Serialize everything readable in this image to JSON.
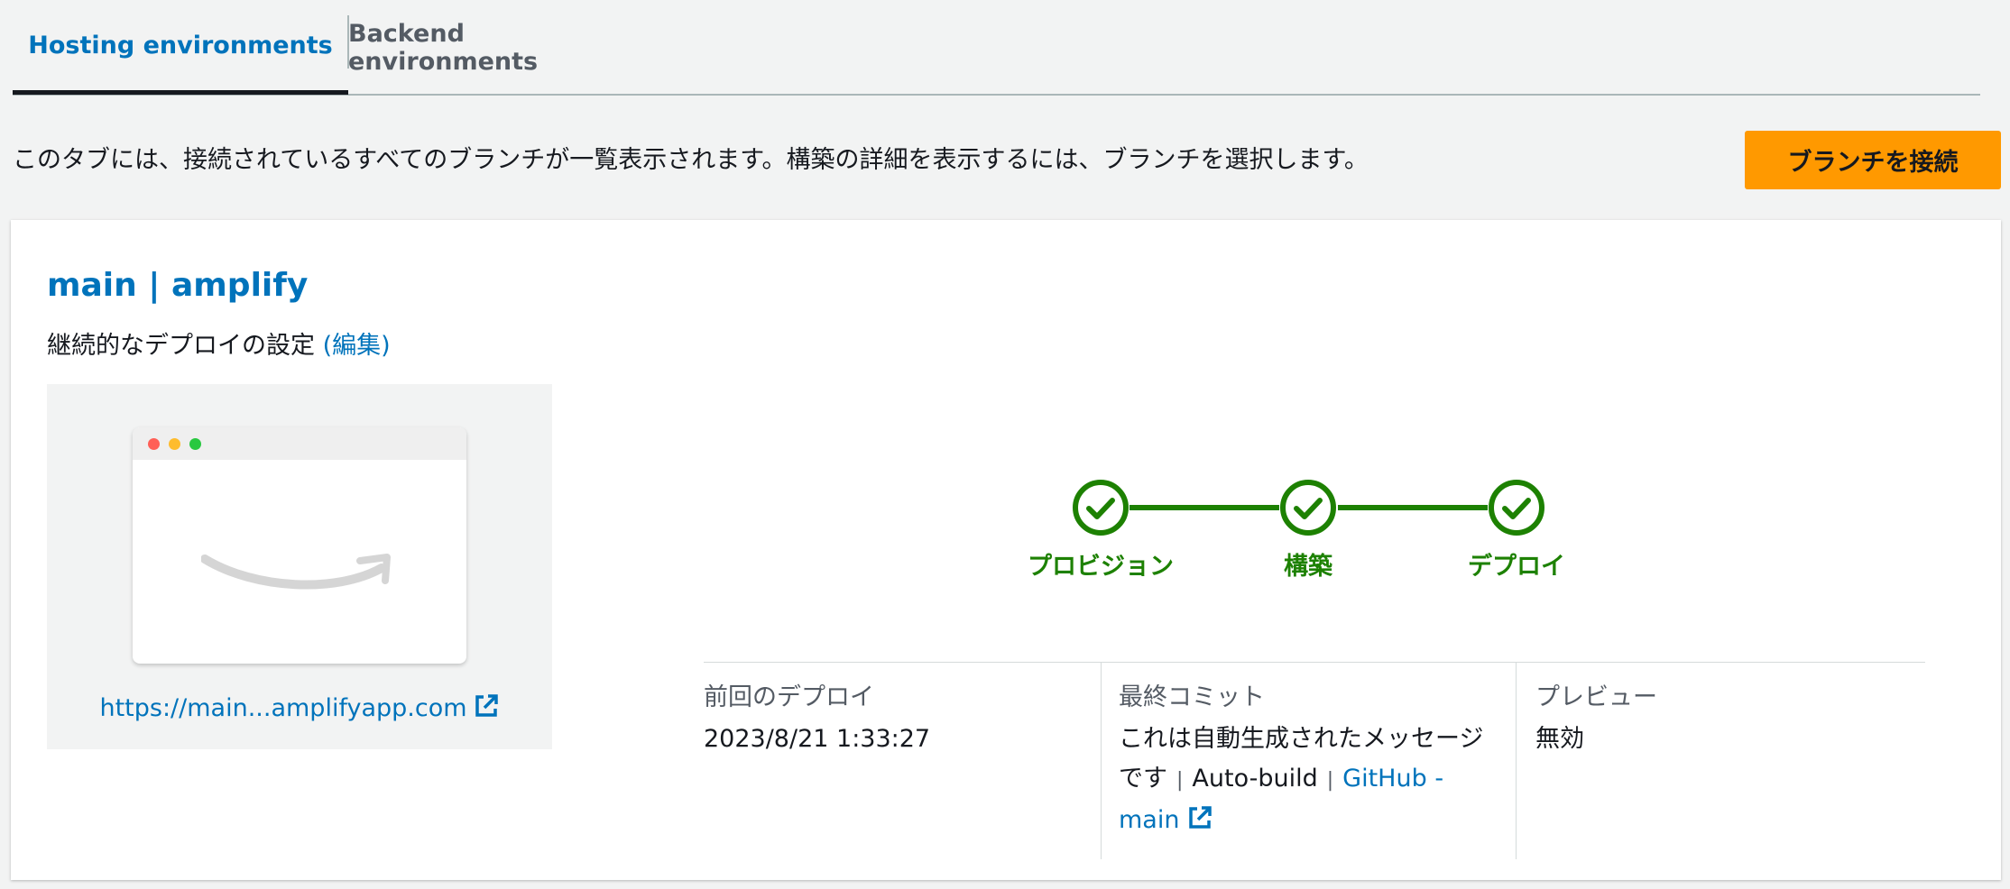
{
  "tabs": [
    {
      "label": "Hosting environments",
      "active": true
    },
    {
      "label": "Backend environments",
      "active": false
    }
  ],
  "description": "このタブには、接続されているすべてのブランチが一覧表示されます。構築の詳細を表示するには、ブランチを選択します。",
  "connect_button": "ブランチを接続",
  "branch": {
    "title": "main | amplify",
    "deploy_setting_label": "継続的なデプロイの設定",
    "edit_link": "(編集)",
    "preview_url": "https://main...amplifyapp.com"
  },
  "pipeline": {
    "steps": [
      {
        "label": "プロビジョン",
        "status": "complete"
      },
      {
        "label": "構築",
        "status": "complete"
      },
      {
        "label": "デプロイ",
        "status": "complete"
      }
    ],
    "color": "#1d8102"
  },
  "info": {
    "last_deploy": {
      "label": "前回のデプロイ",
      "value": "2023/8/21 1:33:27"
    },
    "last_commit": {
      "label": "最終コミット",
      "message": "これは自動生成されたメッセージです",
      "separator": "|",
      "source": "Auto-build",
      "repo_link": "GitHub - main"
    },
    "preview": {
      "label": "プレビュー",
      "value": "無効"
    }
  },
  "colors": {
    "accent": "#0073bb",
    "button": "#ff9900",
    "success": "#1d8102",
    "background": "#f2f3f3"
  }
}
